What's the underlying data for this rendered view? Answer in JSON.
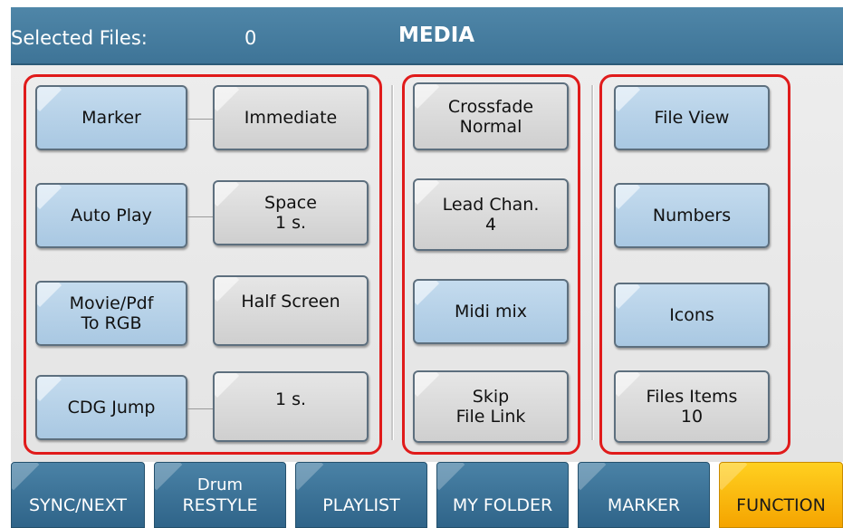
{
  "header": {
    "selected_label": "Selected Files:",
    "selected_count": "0",
    "title": "MEDIA"
  },
  "left_group": {
    "marker": "Marker",
    "marker_value": "Immediate",
    "auto_play": "Auto Play",
    "auto_play_value": "Space\n1 s.",
    "movie_pdf": "Movie/Pdf\nTo RGB",
    "movie_pdf_value": "Half Screen",
    "cdg_jump": "CDG Jump",
    "cdg_jump_value": "1 s."
  },
  "middle_group": {
    "crossfade": "Crossfade\nNormal",
    "lead_chan": "Lead Chan.\n4",
    "midi_mix": "Midi mix",
    "skip_file_link": "Skip\nFile Link"
  },
  "right_group": {
    "file_view": "File View",
    "numbers": "Numbers",
    "icons": "Icons",
    "files_items": "Files Items\n10"
  },
  "tabs": [
    {
      "label": "SYNC/NEXT",
      "active": false
    },
    {
      "label_top": "Drum",
      "label": "RESTYLE",
      "active": false
    },
    {
      "label": "PLAYLIST",
      "active": false
    },
    {
      "label": "MY FOLDER",
      "active": false
    },
    {
      "label": "MARKER",
      "active": false
    },
    {
      "label": "FUNCTION",
      "active": true
    }
  ],
  "colors": {
    "header_blue": "#3e7497",
    "button_blue": "#a9c8e2",
    "button_grey": "#cfcfcf",
    "tab_blue": "#2f6489",
    "tab_active": "#f5a400",
    "highlight_outline": "#e01b1b"
  }
}
